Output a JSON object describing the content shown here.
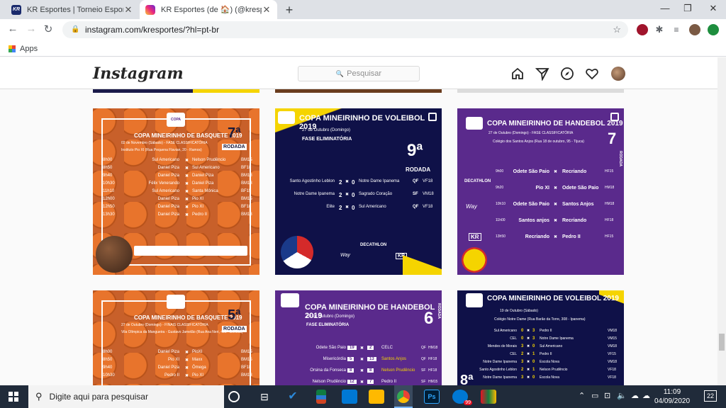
{
  "browser": {
    "tabs": [
      {
        "title": "KR Esportes | Torneio Esportivo E",
        "close": "✕"
      },
      {
        "title": "KR Esportes (de 🏠) (@kresporte",
        "close": "✕"
      }
    ],
    "new_tab": "+",
    "window_controls": {
      "minimize": "—",
      "maximize": "❐",
      "close": "✕"
    },
    "url": "instagram.com/kresportes/?hl=pt-br",
    "bookmarks": {
      "apps": "Apps"
    }
  },
  "instagram": {
    "logo": "Instagram",
    "search_placeholder": "Pesquisar",
    "icons": [
      "home-icon",
      "direct-icon",
      "explore-icon",
      "activity-icon",
      "profile-avatar"
    ]
  },
  "posts": [
    {
      "title": "COPA MINEIRINHO DE BASQUETE 2019",
      "round": "7ª",
      "round_label": "RODADA",
      "date": "02 de Novembro (Sábado) - FASE CLASSIFICATÓRIA",
      "venue": "Instituto Pio XI (Rua Pequena Flavian, 20 - Ramos)",
      "games": [
        {
          "time": "8h00",
          "home": "Sul Americano",
          "away": "Nelson Prudêncio",
          "cat": "BM15"
        },
        {
          "time": "8h50",
          "home": "Daniel Piza",
          "away": "Sul Americano",
          "cat": "BF18"
        },
        {
          "time": "9h40",
          "home": "Daniel Piza",
          "away": "Daniel Piza",
          "cat": "BM18"
        },
        {
          "time": "10h30",
          "home": "Félix Venerando",
          "away": "Daniel Piza",
          "cat": "BM13"
        },
        {
          "time": "11h10",
          "home": "Sul Americano",
          "away": "Santa Mônica",
          "cat": "BF15"
        },
        {
          "time": "12h00",
          "home": "Daniel Piza",
          "away": "Pio XI",
          "cat": "BM15"
        },
        {
          "time": "12h50",
          "home": "Daniel Piza",
          "away": "Pio XI",
          "cat": "BF18"
        },
        {
          "time": "13h30",
          "home": "Daniel Piza",
          "away": "Pedro II",
          "cat": "BM13"
        }
      ]
    },
    {
      "title": "COPA MINEIRINHO DE VOLEIBOL 2019",
      "date": "27 de Outubro (Domingo)",
      "phase": "FASE ELIMINATÓRIA",
      "round": "9ª",
      "round_label": "RODADA",
      "games": [
        {
          "home": "Santo Agostinho Leblon",
          "hs": "2",
          "as": "0",
          "away": "Notre Dame Ipanema",
          "stage": "QF",
          "cat": "VF18"
        },
        {
          "home": "Notre Dame Ipanema",
          "hs": "2",
          "as": "0",
          "away": "Sagrado Coração",
          "stage": "SF",
          "cat": "VM18"
        },
        {
          "home": "Elite",
          "hs": "2",
          "as": "0",
          "away": "Sul Americano",
          "stage": "QF",
          "cat": "VF18"
        }
      ],
      "sponsors": [
        "DECATHLON",
        "Way",
        "KR"
      ]
    },
    {
      "title": "COPA MINEIRINHO DE HANDEBOL 2019",
      "date": "27 de Outubro (Domingo) - FASE CLASSIFICATÓRIA",
      "venue": "Colégio dos Santos Anjos (Rua 18 de outubro, 95 - Tijuca)",
      "round": "7",
      "round_label": "RODADA",
      "games": [
        {
          "time": "9h00",
          "home": "Odete São Paio",
          "away": "Recriando",
          "cat": "HF15"
        },
        {
          "time": "9h20",
          "home": "Pio XI",
          "away": "Odete São Paio",
          "cat": "HM18"
        },
        {
          "time": "10h10",
          "home": "Odete São Paio",
          "away": "Santos Anjos",
          "cat": "HM18"
        },
        {
          "time": "11h00",
          "home": "Santos anjos",
          "away": "Recriando",
          "cat": "HF18"
        },
        {
          "time": "13h50",
          "home": "Recriando",
          "away": "Pedro II",
          "cat": "HF15"
        }
      ],
      "sponsors": [
        "DECATHLON",
        "Way",
        "KR"
      ]
    },
    {
      "title": "COPA MINEIRINHO DE BASQUETE 2019",
      "round": "5ª",
      "round_label": "RODADA",
      "date": "27 de Outubro (Domingo) - FINAIS CLASSIFICATÓRIA",
      "venue": "Vila Olímpica da Mangueira - Gustavo Jamelão (Rua Ana Neri, 400 - Benfica)",
      "games": [
        {
          "time": "8h00",
          "home": "Daniel Piza",
          "away": "PioXI",
          "cat": "BM15"
        },
        {
          "time": "8h50",
          "home": "Pio XI",
          "away": "Maxx",
          "cat": "BM15"
        },
        {
          "time": "9h40",
          "home": "Daniel Piza",
          "away": "Ômega",
          "cat": "BF18"
        },
        {
          "time": "10h30",
          "home": "Pedro II",
          "away": "Pio XI",
          "cat": "BM13"
        }
      ]
    },
    {
      "title": "COPA MINEIRINHO DE HANDEBOL 2019",
      "date": "20 de Outubro (Domingo)",
      "phase": "FASE ELIMINATÓRIA",
      "round": "6",
      "round_label": "RODADA",
      "games": [
        {
          "home": "Odete São Paio",
          "hs": "19",
          "as": "2",
          "away": "CELC",
          "stage": "QF",
          "cat": "HM18"
        },
        {
          "home": "Misericórdia",
          "hs": "5",
          "as": "13",
          "away": "Santos Anjos",
          "stage": "QF",
          "cat": "HF18"
        },
        {
          "home": "Orsina da Fonseca",
          "hs": "8",
          "as": "8",
          "away": "Nelson Prudêncio",
          "stage": "SF",
          "cat": "HF18"
        },
        {
          "home": "Nelson Prudêncio",
          "hs": "12",
          "as": "7",
          "away": "Pedro II",
          "stage": "SF",
          "cat": "HM15"
        }
      ]
    },
    {
      "title": "COPA MINEIRINHO DE VOLEIBOL 2019",
      "date": "19 de Outubro (Sábado)",
      "venue": "Colégio Notre Dame (Rua Barão da Torre, 308 - Ipanema)",
      "round": "8ª",
      "games": [
        {
          "home": "Sul Americano",
          "hs": "0",
          "as": "3",
          "away": "Pedro II",
          "cat": "VM18"
        },
        {
          "home": "CEL",
          "hs": "0",
          "as": "3",
          "away": "Notre Dame Ipanema",
          "cat": "VM15"
        },
        {
          "home": "Mendes de Morais",
          "hs": "3",
          "as": "0",
          "away": "Sul Americano",
          "cat": "VM18"
        },
        {
          "home": "CEL",
          "hs": "2",
          "as": "1",
          "away": "Pedro II",
          "cat": "VF15"
        },
        {
          "home": "Notre Dame Ipanema",
          "hs": "3",
          "as": "0",
          "away": "Escola Nova",
          "cat": "VM18"
        },
        {
          "home": "Santo Agostinho Leblon",
          "hs": "2",
          "as": "1",
          "away": "Nelson Prudêncio",
          "cat": "VF18"
        },
        {
          "home": "Notre Dame Ipanema",
          "hs": "3",
          "as": "0",
          "away": "Escola Nova",
          "cat": "VF18"
        }
      ]
    }
  ],
  "taskbar": {
    "search_placeholder": "Digite aqui para pesquisar",
    "time": "11:09",
    "date": "04/09/2020",
    "notifications": "22",
    "outlook_badge": "99"
  },
  "colors": {
    "orange": "#e8742c",
    "navy": "#0f1148",
    "purple": "#5a2a8c",
    "yellow": "#f5d400"
  }
}
